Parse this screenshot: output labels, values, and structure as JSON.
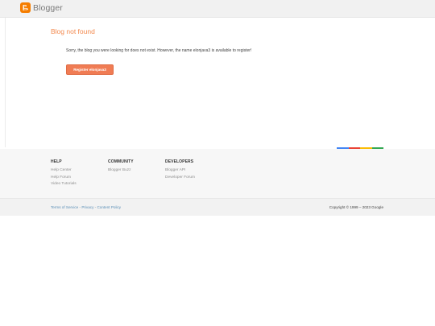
{
  "header": {
    "logo_text": "Blogger"
  },
  "main": {
    "title": "Blog not found",
    "message": "Sorry, the blog you were looking for does not exist. However, the name elonjava3 is available to register!",
    "register_button": "Register elonjava3"
  },
  "colorbar": [
    "#4285f4",
    "#ea4335",
    "#fbbc05",
    "#34a853"
  ],
  "footer": {
    "help": {
      "heading": "HELP",
      "links": [
        "Help Center",
        "Help Forum",
        "Video Tutorials"
      ]
    },
    "community": {
      "heading": "COMMUNITY",
      "links": [
        "Blogger Buzz"
      ]
    },
    "developers": {
      "heading": "DEVELOPERS",
      "links": [
        "Blogger API",
        "Developer Forum"
      ]
    }
  },
  "subfooter": {
    "terms": "Terms of Service",
    "privacy": "Privacy",
    "content_policy": "Content Policy",
    "separator": " - ",
    "copyright": "Copyright © 1999 – 2023 Google"
  }
}
